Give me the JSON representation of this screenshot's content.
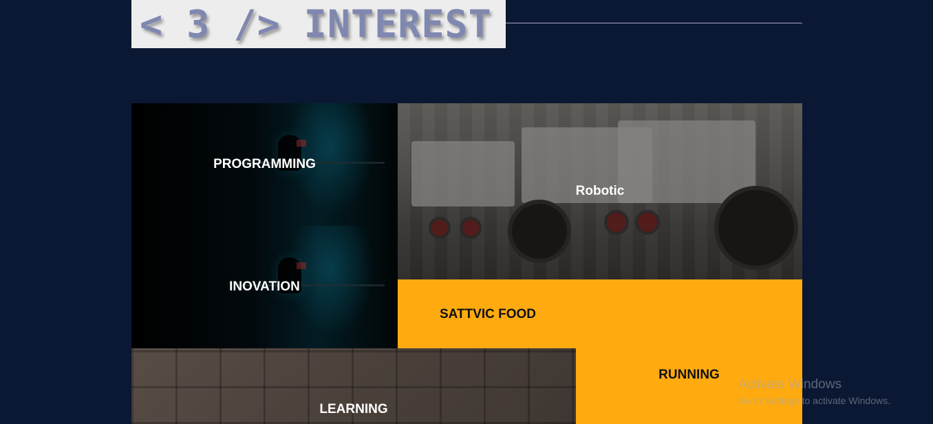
{
  "heading": {
    "title": "< 3 /> INTEREST"
  },
  "tiles": {
    "programming": "PROGRAMMING",
    "inovation": "INOVATION",
    "robotic": "Robotic",
    "sattvic_food": "SATTVIC FOOD",
    "running": "RUNNING",
    "learning": "LEARNING"
  },
  "watermark": {
    "line1": "Activate Windows",
    "line2": "Go to Settings to activate Windows."
  },
  "colors": {
    "background": "#0b1833",
    "accent_yellow": "#ffab0f",
    "heading_text": "#8088b0"
  }
}
